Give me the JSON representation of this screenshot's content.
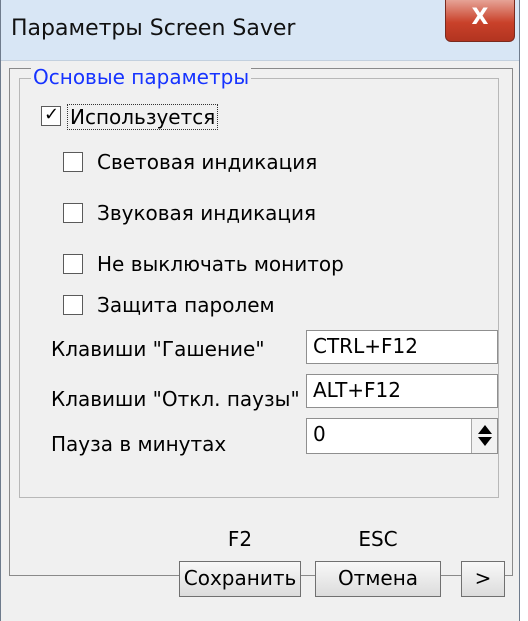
{
  "window": {
    "title": "Параметры Screen Saver",
    "close_symbol": "X"
  },
  "group": {
    "legend": "Основые параметры"
  },
  "checkboxes": [
    {
      "label": "Используется",
      "checked": true
    },
    {
      "label": "Световая индикация",
      "checked": false
    },
    {
      "label": "Звуковая индикация",
      "checked": false
    },
    {
      "label": "Не выключать монитор",
      "checked": false
    },
    {
      "label": "Защита паролем",
      "checked": false
    }
  ],
  "fields": {
    "blank_keys": {
      "label": "Клавиши \"Гашение\"",
      "value": "CTRL+F12"
    },
    "unpause_keys": {
      "label": "Клавиши \"Откл. паузы\"",
      "value": "ALT+F12"
    },
    "pause_minutes": {
      "label": "Пауза в минутах",
      "value": "0"
    }
  },
  "buttons": {
    "save": {
      "hotkey": "F2",
      "label": "Сохранить"
    },
    "cancel": {
      "hotkey": "ESC",
      "label": "Отмена"
    },
    "more": {
      "label": ">"
    }
  }
}
